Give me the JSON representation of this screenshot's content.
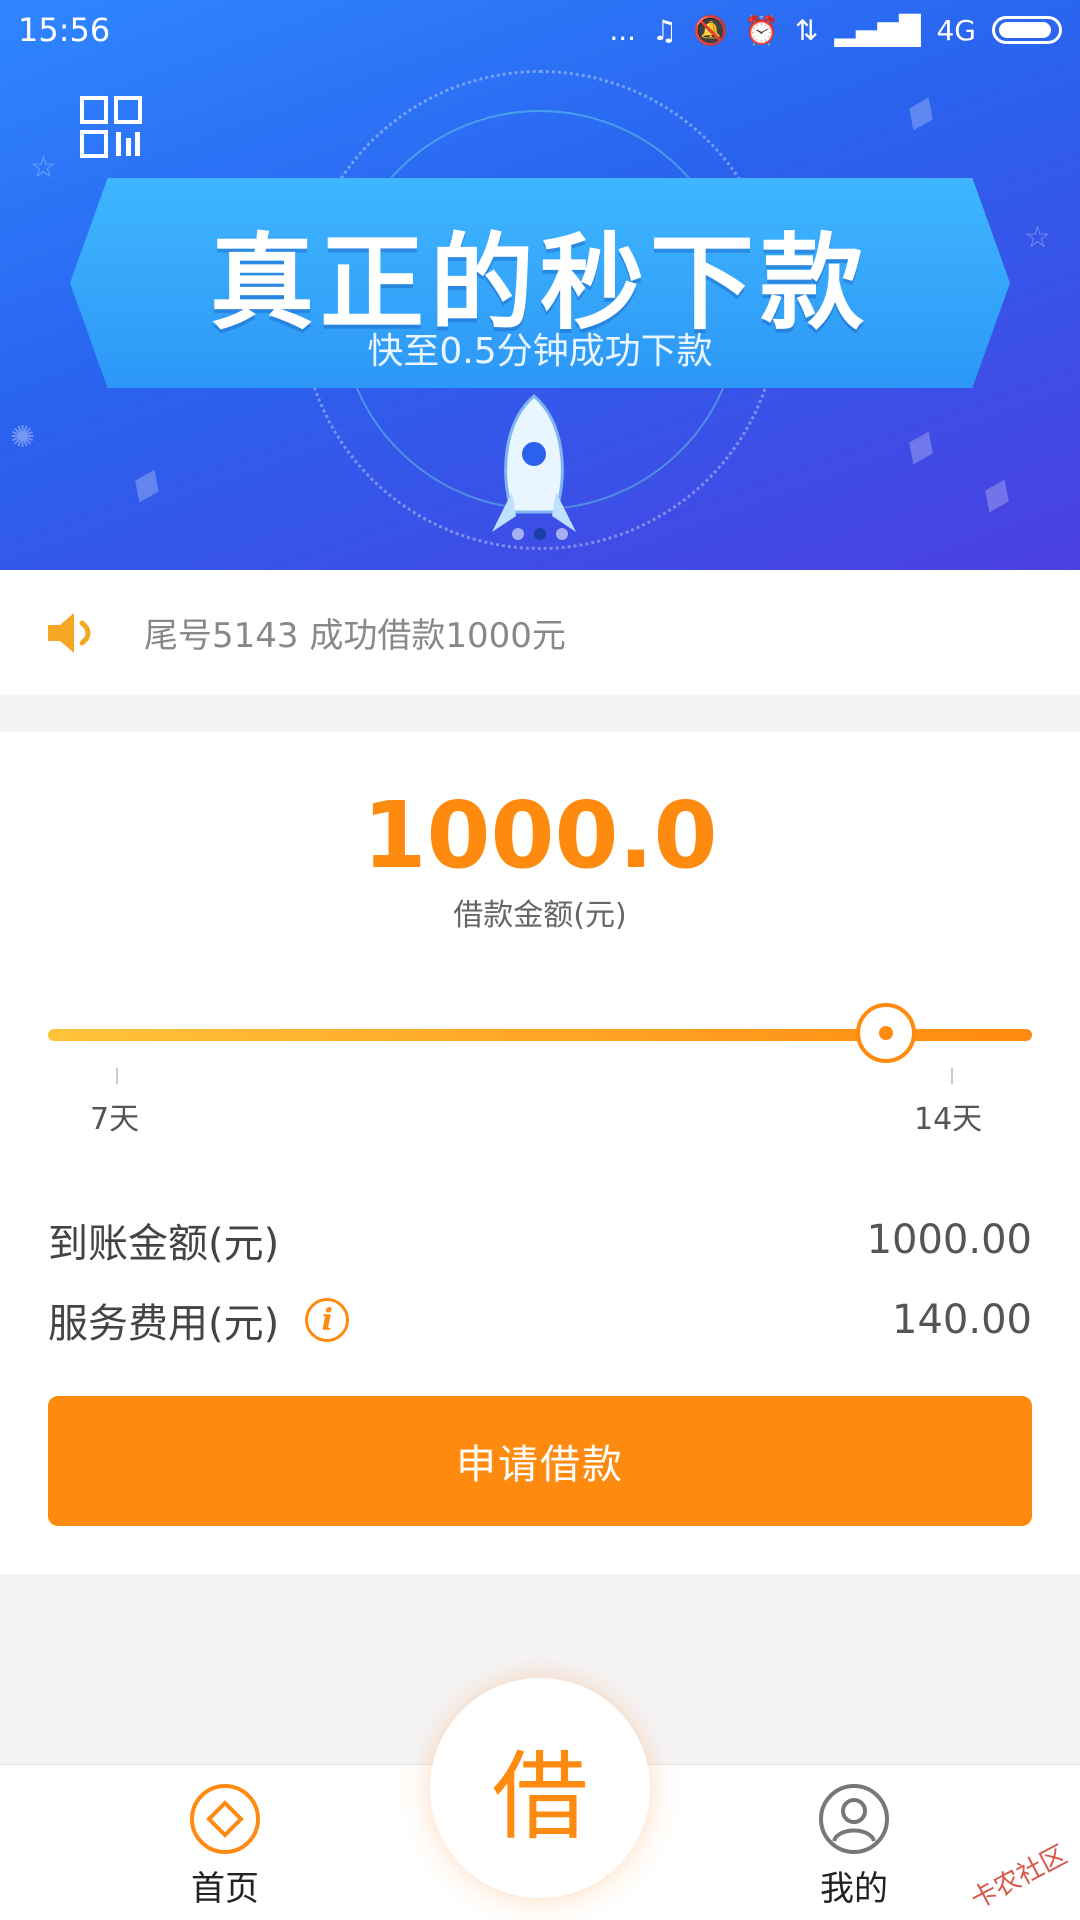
{
  "status_bar": {
    "time": "15:56",
    "dots": "...",
    "network": "4G"
  },
  "banner": {
    "headline": "真正的秒下款",
    "subline": "快至0.5分钟成功下款",
    "slide_count": 3,
    "active_slide": 2
  },
  "notice": {
    "text": "尾号5143 成功借款1000元"
  },
  "loan": {
    "amount": "1000.0",
    "amount_label": "借款金额(元)",
    "term_min_label": "7天",
    "term_max_label": "14天",
    "term_selected_days": 14,
    "received_label": "到账金额(元)",
    "received_value": "1000.00",
    "fee_label": "服务费用(元)",
    "fee_value": "140.00",
    "apply_button": "申请借款"
  },
  "bottom_nav": {
    "home_label": "首页",
    "borrow_label": "借",
    "mine_label": "我的"
  },
  "watermark": "卡农社区",
  "colors": {
    "accent": "#ff8a10",
    "banner_blue": "#2a62ee"
  }
}
